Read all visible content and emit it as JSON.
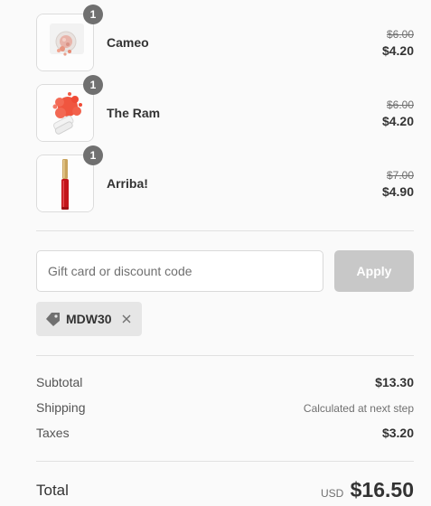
{
  "line_items": [
    {
      "name": "Cameo",
      "quantity": "1",
      "original_price": "$6.00",
      "sale_price": "$4.20",
      "thumbnail_icon": "cameo-blush-compact-icon"
    },
    {
      "name": "The Ram",
      "quantity": "1",
      "original_price": "$6.00",
      "sale_price": "$4.20",
      "thumbnail_icon": "ram-pigment-splash-icon"
    },
    {
      "name": "Arriba!",
      "quantity": "1",
      "original_price": "$7.00",
      "sale_price": "$4.90",
      "thumbnail_icon": "arriba-lip-gloss-icon"
    }
  ],
  "discount": {
    "placeholder": "Gift card or discount code",
    "value": "",
    "apply_label": "Apply",
    "applied_code": "MDW30"
  },
  "summary": {
    "subtotal_label": "Subtotal",
    "subtotal_value": "$13.30",
    "shipping_label": "Shipping",
    "shipping_value": "Calculated at next step",
    "taxes_label": "Taxes",
    "taxes_value": "$3.20",
    "total_label": "Total",
    "total_currency": "USD",
    "total_value": "$16.50"
  },
  "colors": {
    "badge": "#707070",
    "apply_button_disabled": "#c8c8c8",
    "tag_background": "#e6e6e6",
    "divider": "#e1e1e1"
  }
}
